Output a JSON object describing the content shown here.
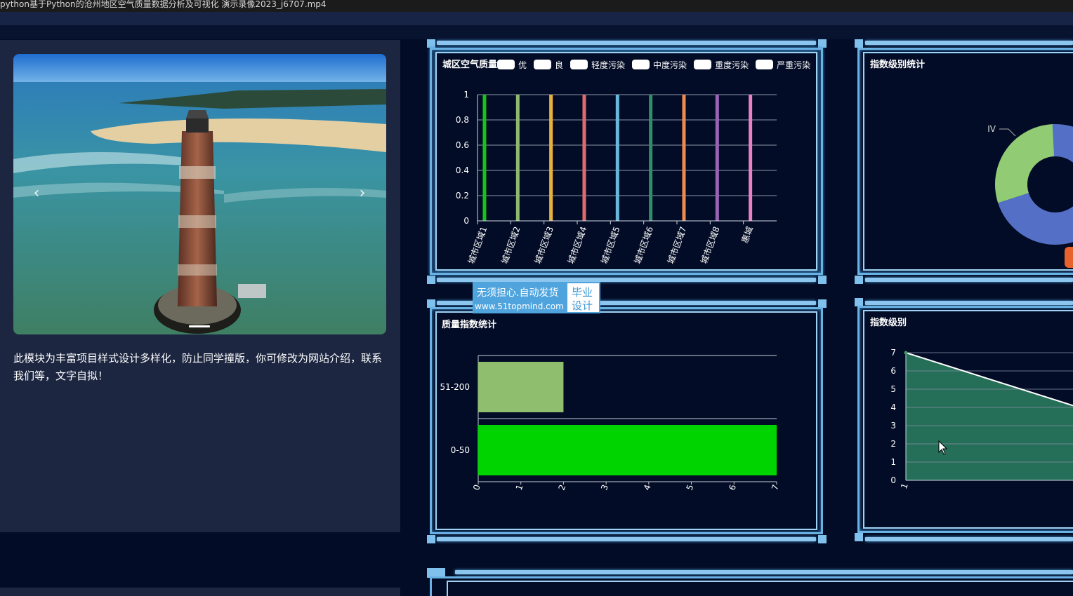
{
  "window": {
    "title": "python基于Python的沧州地区空气质量数据分析及可视化 演示录像2023_j6707.mp4"
  },
  "carousel": {
    "prev_label": "‹",
    "next_label": "›"
  },
  "intro": {
    "text": "此模块为丰富项目样式设计多样化，防止同学撞版，你可修改为网站介绍，联系我们等，文字自拟！"
  },
  "promo": {
    "line1": "无须担心.自动发货",
    "line2": "www.51topmind.com",
    "badge_line1": "毕业",
    "badge_line2": "设计"
  },
  "panels": {
    "air_quality": {
      "title": "城区空气质量"
    },
    "index_level_stats": {
      "title": "指数级别统计"
    },
    "quality_index_stats": {
      "title": "质量指数统计"
    },
    "index_level": {
      "title": "指数级别"
    }
  },
  "colors": {
    "frame": "#6ab2e4",
    "panel_bg": "#030c26",
    "left_panel": "#1c2640"
  },
  "chart_data": [
    {
      "type": "bar",
      "title": "城区空气质量",
      "legend": [
        "优",
        "良",
        "轻度污染",
        "中度污染",
        "重度污染",
        "严重污染"
      ],
      "categories": [
        "城市区域1",
        "城市区域2",
        "城市区域3",
        "城市区域4",
        "城市区域5",
        "城市区域6",
        "城市区域7",
        "城市区域8",
        "惠城"
      ],
      "values": [
        1,
        1,
        1,
        1,
        1,
        1,
        1,
        1,
        1
      ],
      "bar_colors": [
        "#16c316",
        "#8fba6e",
        "#e8b13c",
        "#e06b6b",
        "#6ab7de",
        "#2f8d6a",
        "#ee8a4d",
        "#9a63b6",
        "#e882c6"
      ],
      "yticks": [
        "0",
        "0.2",
        "0.4",
        "0.6",
        "0.8",
        "1"
      ],
      "ylim": [
        0,
        1
      ],
      "grid": true,
      "legend_position": "top"
    },
    {
      "type": "pie",
      "title": "指数级别统计",
      "labels": [
        "IV"
      ],
      "colors": [
        "#5470c6",
        "#91cc75"
      ]
    },
    {
      "type": "bar",
      "orientation": "horizontal",
      "title": "质量指数统计",
      "categories": [
        "0-50",
        "51-200"
      ],
      "values": [
        7,
        2
      ],
      "bar_colors": [
        "#00d400",
        "#8fbf6e"
      ],
      "xticks": [
        "0",
        "1",
        "2",
        "3",
        "4",
        "5",
        "6",
        "7"
      ],
      "xlim": [
        0,
        7
      ]
    },
    {
      "type": "area",
      "title": "指数级别",
      "x": [
        "1"
      ],
      "yticks": [
        "0",
        "1",
        "2",
        "3",
        "4",
        "5",
        "6",
        "7"
      ],
      "ylim": [
        0,
        7
      ],
      "values": [
        7
      ],
      "line_color": "#ffffff",
      "fill_color": "#256f58"
    }
  ]
}
